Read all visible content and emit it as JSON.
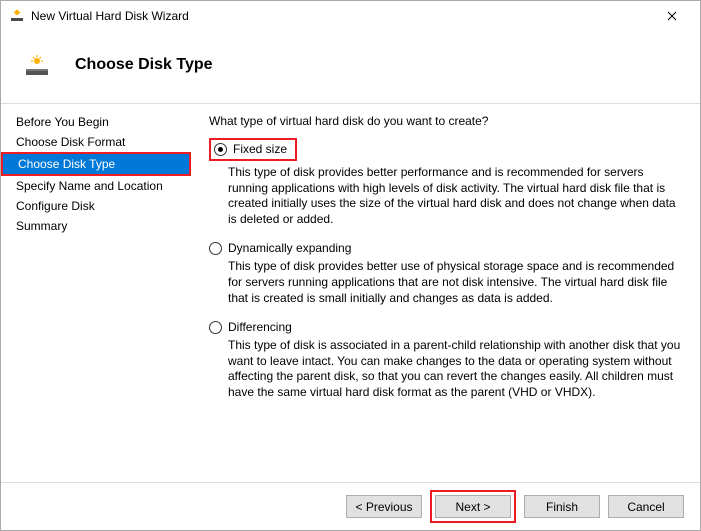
{
  "titlebar": {
    "title": "New Virtual Hard Disk Wizard"
  },
  "header": {
    "title": "Choose Disk Type"
  },
  "sidebar": {
    "items": [
      {
        "label": "Before You Begin"
      },
      {
        "label": "Choose Disk Format"
      },
      {
        "label": "Choose Disk Type"
      },
      {
        "label": "Specify Name and Location"
      },
      {
        "label": "Configure Disk"
      },
      {
        "label": "Summary"
      }
    ]
  },
  "content": {
    "prompt": "What type of virtual hard disk do you want to create?",
    "options": [
      {
        "label": "Fixed size",
        "desc": "This type of disk provides better performance and is recommended for servers running applications with high levels of disk activity. The virtual hard disk file that is created initially uses the size of the virtual hard disk and does not change when data is deleted or added."
      },
      {
        "label": "Dynamically expanding",
        "desc": "This type of disk provides better use of physical storage space and is recommended for servers running applications that are not disk intensive. The virtual hard disk file that is created is small initially and changes as data is added."
      },
      {
        "label": "Differencing",
        "desc": "This type of disk is associated in a parent-child relationship with another disk that you want to leave intact. You can make changes to the data or operating system without affecting the parent disk, so that you can revert the changes easily. All children must have the same virtual hard disk format as the parent (VHD or VHDX)."
      }
    ]
  },
  "buttons": {
    "previous": "< Previous",
    "next": "Next >",
    "finish": "Finish",
    "cancel": "Cancel"
  }
}
